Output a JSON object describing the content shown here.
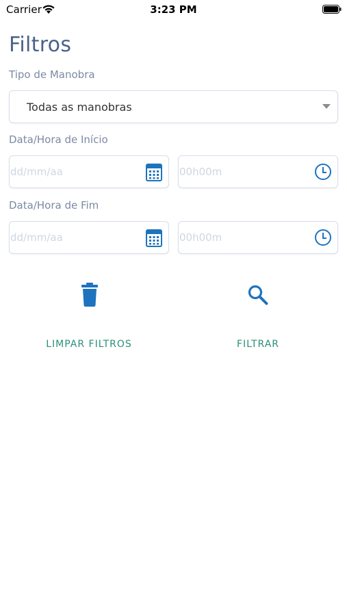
{
  "status_bar": {
    "carrier": "Carrier",
    "time": "3:23 PM",
    "icons": [
      "wifi-icon",
      "battery-icon"
    ]
  },
  "title": "Filtros",
  "maneuver_type": {
    "label": "Tipo de Manobra",
    "selected": "Todas as manobras"
  },
  "start": {
    "label": "Data/Hora de Início",
    "date_placeholder": "dd/mm/aa",
    "time_placeholder": "00h00m"
  },
  "end": {
    "label": "Data/Hora de Fim",
    "date_placeholder": "dd/mm/aa",
    "time_placeholder": "00h00m"
  },
  "actions": {
    "clear_label": "LIMPAR FILTROS",
    "filter_label": "FILTRAR"
  },
  "colors": {
    "title": "#4a628a",
    "icon_blue": "#1e73be",
    "action_green": "#2a8f7a",
    "border": "#d6ddec"
  }
}
